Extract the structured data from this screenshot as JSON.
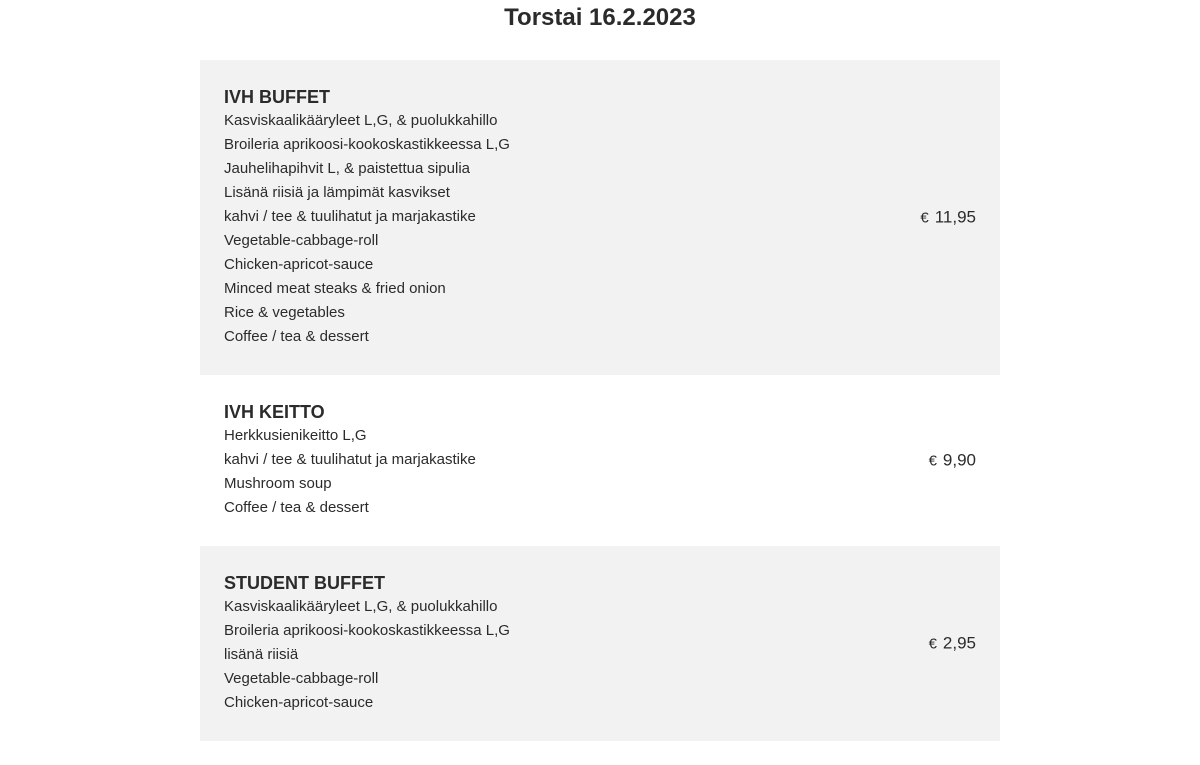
{
  "date_heading": "Torstai 16.2.2023",
  "menu": {
    "items": [
      {
        "name": "IVH BUFFET",
        "lines": [
          "Kasviskaalikääryleet L,G, & puolukkahillo",
          "Broileria aprikoosi-kookoskastikkeessa L,G",
          "Jauhelihapihvit L, & paistettua sipulia",
          "Lisänä riisiä ja lämpimät kasvikset",
          "kahvi / tee & tuulihatut ja marjakastike",
          "Vegetable-cabbage-roll",
          "Chicken-apricot-sauce",
          "Minced meat steaks & fried onion",
          "Rice & vegetables",
          "Coffee / tea & dessert"
        ],
        "currency": "€",
        "price": "11,95"
      },
      {
        "name": "IVH KEITTO",
        "lines": [
          "Herkkusienikeitto L,G",
          "kahvi / tee & tuulihatut ja marjakastike",
          "Mushroom soup",
          "Coffee / tea & dessert"
        ],
        "currency": "€",
        "price": "9,90"
      },
      {
        "name": "STUDENT BUFFET",
        "lines": [
          "Kasviskaalikääryleet L,G, & puolukkahillo",
          "Broileria aprikoosi-kookoskastikkeessa L,G",
          "lisänä riisiä",
          "Vegetable-cabbage-roll",
          "Chicken-apricot-sauce"
        ],
        "currency": "€",
        "price": "2,95"
      }
    ]
  },
  "colors": {
    "shaded_background": "#f2f2f2",
    "text": "#2b2b2b"
  }
}
